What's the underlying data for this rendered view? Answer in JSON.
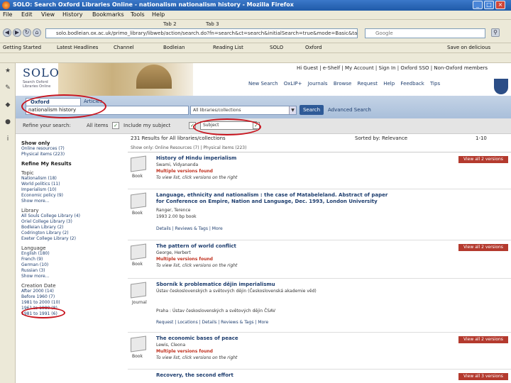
{
  "window": {
    "title": "SOLO: Search Oxford Libraries Online - nationalism nationalism history - Mozilla Firefox"
  },
  "menu": [
    "File",
    "Edit",
    "View",
    "History",
    "Bookmarks",
    "Tools",
    "Help"
  ],
  "tabs": [
    "SOLO: ... nationalism history",
    "Tab 2",
    "Tab 3"
  ],
  "url": "solo.bodleian.ox.ac.uk/primo_library/libweb/action/search.do?fn=search&ct=search&initialSearch=true&mode=Basic&tab=...&indx=1&dum=true&srt=rank&vid=OXVU1&frbg=&tb=t&vl(freeText0)=nationalism+history&scp.scps=scope",
  "search_engine_placeholder": "Google",
  "bookmarks": [
    "Getting Started",
    "Latest Headlines",
    "Channel",
    "Bodleian",
    "Reading List",
    "SOLO",
    "Oxford",
    "Save on delicious"
  ],
  "header": {
    "logo": "SOLO",
    "logo_sub": "Search Oxford Libraries Online",
    "top_links": "Hi Guest  |  e-Shelf  |  My Account  |  Sign In  |  Oxford SSO  |  Non-Oxford members",
    "nav_links": [
      "New Search",
      "OxLIP+",
      "Journals",
      "Browse",
      "Request",
      "Help",
      "Feedback",
      "Tips"
    ]
  },
  "search": {
    "tab_primary": "Oxford Collections",
    "tab_secondary": "Articles",
    "query": "nationalism history",
    "scope": "All libraries/collections",
    "go_label": "Search",
    "advanced": "Advanced Search"
  },
  "refine": {
    "label": "Refine your search:",
    "opt1": "All items",
    "opt2": "Include my subject",
    "subject_value": "Subject"
  },
  "sidebar": {
    "show_only": "Show only",
    "show_only_items": [
      "Online resources (7)",
      "Physical items (223)"
    ],
    "refine_title": "Refine My Results",
    "topic_title": "Topic",
    "topic_items": [
      "Nationalism (18)",
      "World politics (11)",
      "Imperialism (10)",
      "Economic policy (9)",
      "Show more..."
    ],
    "library_title": "Library",
    "library_items": [
      "All Souls College Library (4)",
      "Oriel College Library (3)",
      "Bodleian Library (2)",
      "Codrington Library (2)",
      "Exeter College Library (2)"
    ],
    "language_title": "Language",
    "language_items": [
      "English (180)",
      "French (9)",
      "German (10)",
      "Russian (3)",
      "Show more..."
    ],
    "date_title": "Creation Date",
    "date_items": [
      "After 2000 (14)",
      "Before 1960 (7)",
      "1981 to 2000 (10)",
      "1961 to 1980 (8)",
      "1981 to 1991 (6)"
    ]
  },
  "results_bar": {
    "count": "231 Results for All libraries/collections",
    "sort": "Sorted by: Relevance",
    "range": "1-10",
    "filters": "Show only: Online Resources (7) | Physical items (223)"
  },
  "results": [
    {
      "title": "History of Hindu imperialism",
      "line1": "Swami, Vidyananda",
      "status": "Multiple versions found",
      "line2": "To view list, click versions on the right",
      "format": "Book",
      "button": "View all 2 versions"
    },
    {
      "title": "Language, ethnicity and nationalism : the case of Matabeleland. Abstract of paper for Conference on Empire, Nation and Language, Dec. 1993, London University",
      "line1": "Ranger, Terence",
      "status": "",
      "line2": "1993 2.00 bp book",
      "format": "Book",
      "button": "",
      "actions": "Details | Reviews & Tags | More"
    },
    {
      "title": "The pattern of world conflict",
      "line1": "George, Herbert",
      "status": "Multiple versions found",
      "line2": "To view list, click versions on the right",
      "format": "Book",
      "button": "View all 2 versions"
    },
    {
      "title": "Sborník k problematice dějin imperialismu",
      "line1": "Ústav československých a světových dějin (Československá akademie věd)",
      "status": "",
      "line2": "Praha : Ústav československých a světových dějin ČSAV",
      "format": "Journal",
      "button": "",
      "actions": "Request | Locations | Details | Reviews & Tags | More"
    },
    {
      "title": "The economic bases of peace",
      "line1": "Lewis, Cleona",
      "status": "Multiple versions found",
      "line2": "To view list, click versions on the right",
      "format": "Book",
      "button": "View all 2 versions"
    },
    {
      "title": "Recovery, the second effort",
      "line1": "",
      "status": "",
      "line2": "",
      "format": "",
      "button": "View all 3 versions"
    }
  ]
}
